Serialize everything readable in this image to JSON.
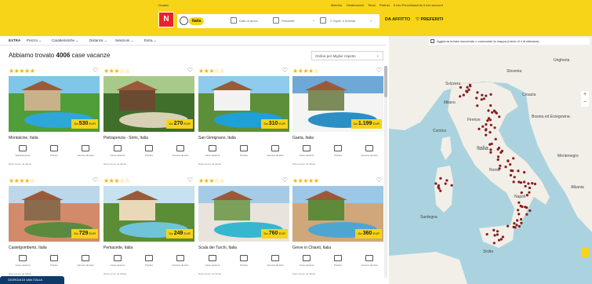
{
  "header": {
    "links": [
      "Guasto",
      "Marchio",
      "Destinazioni",
      "Tema",
      "Partner",
      "Il mio Pernottamento",
      "Il mio account"
    ],
    "logo_text": "N",
    "search": {
      "country": "Italia",
      "dates": "Date di arrivo",
      "duration": "Flessibile",
      "guests": "2 Ospiti, 0 Animali"
    },
    "btn_rent": "DA AFFITTO",
    "btn_favorites": "PREFERITI"
  },
  "filters": [
    "EXTRA",
    "Prezzo",
    "Caratteristiche",
    "Distanze",
    "Selezioni",
    "Extra"
  ],
  "results": {
    "prefix": "Abbiamo trovato",
    "count": "4006",
    "suffix": "case vacanze"
  },
  "sort": {
    "label": "Ordina per Miglior rispetto"
  },
  "listings": [
    {
      "stars": "★★★★★",
      "price_prefix": "Da",
      "price": "530",
      "currency": "EUR",
      "location": "Montalcine, Italia",
      "features": [
        "Appartamento",
        "Piscina",
        "Camera da letto"
      ],
      "note": "Ripromesso da fabale"
    },
    {
      "stars": "★★★☆☆",
      "price_prefix": "Da",
      "price": "270",
      "currency": "EUR",
      "location": "Pietrapenzia - Sirmi, Italia",
      "features": [
        "Casa vacanze",
        "Piscina",
        "Camera da letto"
      ],
      "note": "Ripromesso da fabale"
    },
    {
      "stars": "★★★☆☆",
      "price_prefix": "Da",
      "price": "310",
      "currency": "EUR",
      "location": "San Gimignano, Italia",
      "features": [
        "Casa vacanze",
        "Piscina",
        "Camera da letto"
      ],
      "note": "Ripromesso da fabale"
    },
    {
      "stars": "★★★★☆",
      "price_prefix": "Da",
      "price": "1.199",
      "currency": "EUR",
      "location": "Gaeta, Italia",
      "features": [
        "Casa vacanze",
        "Piscina",
        "Camera da letto"
      ],
      "note": "Ripromesso da fabale"
    },
    {
      "stars": "★★★★☆",
      "price_prefix": "Da",
      "price": "729",
      "currency": "EUR",
      "location": "Castelgomberto, Italia",
      "features": [
        "Casa vacanze",
        "Piscina",
        "Camera da letto"
      ],
      "note": "Ripromesso da fabale"
    },
    {
      "stars": "★★★☆☆",
      "price_prefix": "Da",
      "price": "249",
      "currency": "EUR",
      "location": "Pemacette, Italia",
      "features": [
        "Casa vacanze",
        "Piscina",
        "Camera da letto"
      ],
      "note": "Ripromesso da fabale"
    },
    {
      "stars": "★★★☆☆",
      "price_prefix": "Da",
      "price": "760",
      "currency": "EUR",
      "location": "Scala dei Turchi, Italia",
      "features": [
        "Casa vacanze",
        "Piscina",
        "Camera da letto"
      ],
      "note": "Ripromesso da fabale"
    },
    {
      "stars": "★★★★★",
      "price_prefix": "Da",
      "price": "360",
      "currency": "EUR",
      "location": "Greve in Chianti, Italia",
      "features": [
        "Casa vacanze",
        "Piscina",
        "Camera da letto"
      ],
      "note": "Ripromesso da fabale"
    }
  ],
  "map": {
    "checkbox_label": "Aggiorna la lista muovendo o zoomando la mappa (meno di 4 di distanza)",
    "zoom_in": "+",
    "zoom_out": "−",
    "labels": [
      "Svizzera",
      "Slovenia",
      "Croazia",
      "Bosnia ed Erzegovina",
      "Italia",
      "Corsica",
      "Sardegna",
      "Roma",
      "Napoli",
      "Sicilia",
      "Firenze",
      "Milano",
      "Montenegro",
      "Albania",
      "Ungheria"
    ]
  },
  "cta": {
    "label": "GIORGIA DI VAN ITALIA"
  },
  "colors": {
    "brand_yellow": "#f7d417",
    "brand_red": "#e8232a",
    "map_water": "#aad3df",
    "map_land": "#f2efe9",
    "marker": "#8b1a1a"
  }
}
